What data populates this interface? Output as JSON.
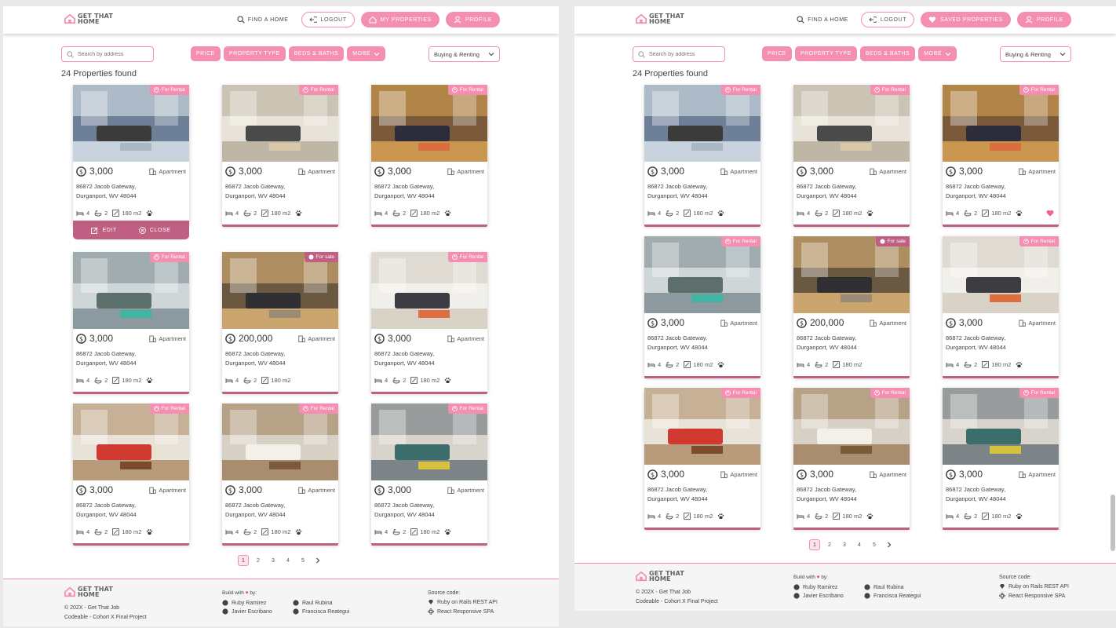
{
  "brand": {
    "line1": "GET THAT",
    "line2": "HOME",
    "accent": "#f48fb1",
    "dark_accent": "#bf5f82"
  },
  "left": {
    "nav": {
      "find": "FIND A HOME",
      "logout": "LOGOUT",
      "primary": "MY PROPERTIES",
      "profile": "PROFILE"
    },
    "search_placeholder": "Search by address",
    "filters": [
      "PRICE",
      "PROPERTY TYPE",
      "BEDS & BATHS",
      "MORE"
    ],
    "select": "Buying & Renting",
    "count": "24 Properties found",
    "actions": {
      "edit": "EDIT",
      "close": "CLOSE"
    },
    "pages": [
      "1",
      "2",
      "3",
      "4",
      "5"
    ]
  },
  "right": {
    "nav": {
      "find": "FIND A HOME",
      "logout": "LOGOUT",
      "primary": "SAVED PROPERTIES",
      "profile": "PROFILE"
    },
    "search_placeholder": "Search by address",
    "filters": [
      "PRICE",
      "PROPERTY TYPE",
      "BEDS & BATHS",
      "MORE"
    ],
    "select": "Buying & Renting",
    "count": "24 Properties found",
    "pages": [
      "1",
      "2",
      "3",
      "4",
      "5"
    ]
  },
  "cards": [
    {
      "badge": "For Rental",
      "price": "3,000",
      "type": "Apartment",
      "addr1": "86872 Jacob Gateway,",
      "addr2": "Durganport, WV 48044",
      "beds": "4",
      "baths": "2",
      "area": "180 m2",
      "pets": true
    },
    {
      "badge": "For Rental",
      "price": "3,000",
      "type": "Apartment",
      "addr1": "86872 Jacob Gateway,",
      "addr2": "Durganport, WV 48044",
      "beds": "4",
      "baths": "2",
      "area": "180 m2",
      "pets": true
    },
    {
      "badge": "For Rental",
      "price": "3,000",
      "type": "Apartment",
      "addr1": "86872 Jacob Gateway,",
      "addr2": "Durganport, WV 48044",
      "beds": "4",
      "baths": "2",
      "area": "180 m2",
      "pets": true
    },
    {
      "badge": "For Rental",
      "price": "3,000",
      "type": "Apartment",
      "addr1": "86872 Jacob Gateway,",
      "addr2": "Durganport, WV 48044",
      "beds": "4",
      "baths": "2",
      "area": "180 m2",
      "pets": true
    },
    {
      "badge": "For sale",
      "price": "200,000",
      "type": "Apartment",
      "addr1": "86872 Jacob Gateway,",
      "addr2": "Durganport, WV 48044",
      "beds": "4",
      "baths": "2",
      "area": "180 m2",
      "pets": false
    },
    {
      "badge": "For Rental",
      "price": "3,000",
      "type": "Apartment",
      "addr1": "86872 Jacob Gateway,",
      "addr2": "Durganport, WV 48044",
      "beds": "4",
      "baths": "2",
      "area": "180 m2",
      "pets": true
    },
    {
      "badge": "For Rental",
      "price": "3,000",
      "type": "Apartment",
      "addr1": "86872 Jacob Gateway,",
      "addr2": "Durganport, WV 48044",
      "beds": "4",
      "baths": "2",
      "area": "180 m2",
      "pets": true
    },
    {
      "badge": "For Rental",
      "price": "3,000",
      "type": "Apartment",
      "addr1": "86872 Jacob Gateway,",
      "addr2": "Durganport, WV 48044",
      "beds": "4",
      "baths": "2",
      "area": "180 m2",
      "pets": true
    },
    {
      "badge": "For Rental",
      "price": "3,000",
      "type": "Apartment",
      "addr1": "86872 Jacob Gateway,",
      "addr2": "Durganport, WV 48044",
      "beds": "4",
      "baths": "2",
      "area": "180 m2",
      "pets": true
    }
  ],
  "footer": {
    "copy1": "© 202X - Get That Job",
    "copy2": "Codeable - Cohort X Final Project",
    "build_with": "Build with",
    "by": "by:",
    "authors": [
      "Ruby Ramirez",
      "Raul Rubina",
      "Javier Escribano",
      "Francisca Reategui"
    ],
    "source_title": "Source code:",
    "sources": [
      "Ruby on Rails REST API",
      "React Responsive SPA"
    ]
  }
}
